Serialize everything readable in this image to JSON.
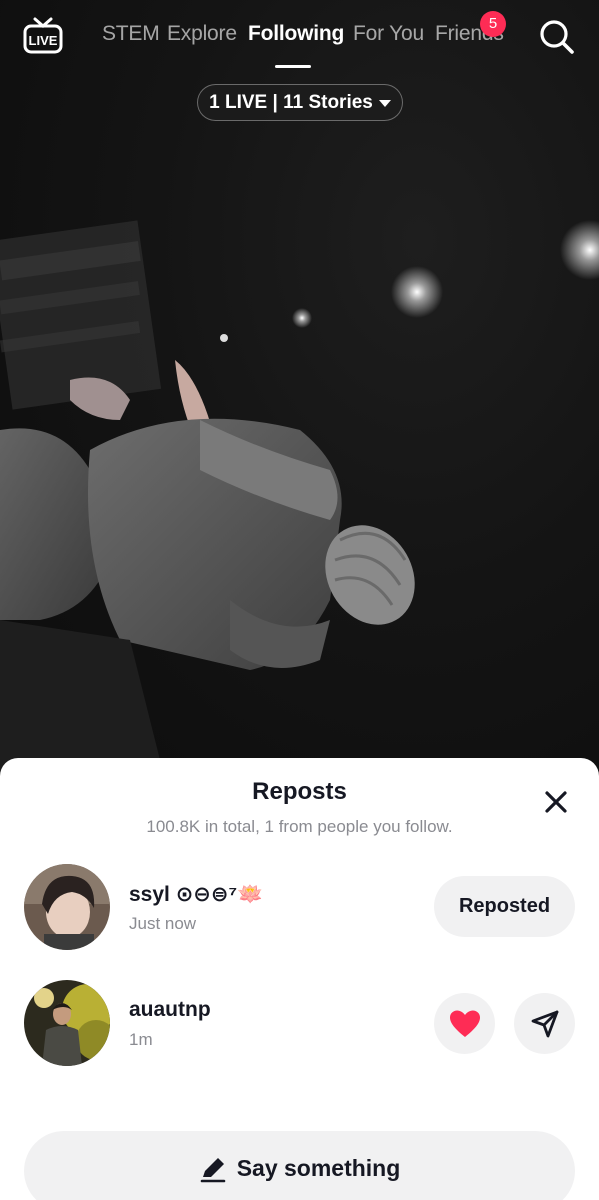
{
  "header": {
    "live_label": "LIVE",
    "tabs": [
      {
        "label": "STEM"
      },
      {
        "label": "Explore"
      },
      {
        "label": "Following"
      },
      {
        "label": "For You"
      },
      {
        "label": "Friends"
      }
    ],
    "active_tab": "Following",
    "friends_badge": "5",
    "stories_pill": "1 LIVE | 11 Stories",
    "icons": [
      "live-tv-icon",
      "search-icon",
      "caret-down-icon"
    ]
  },
  "reposts_sheet": {
    "title": "Reposts",
    "subtitle": "100.8K in total, 1 from people you follow.",
    "users": [
      {
        "name": "ssyl ⊙⊖⊜⁷🪷",
        "time": "Just now",
        "action_label": "Reposted"
      },
      {
        "name": "auautnp",
        "time": "1m",
        "actions": [
          "heart-icon",
          "send-icon"
        ]
      }
    ],
    "comment_placeholder": "Say something",
    "colors": {
      "heart": "#fe2c55",
      "badge": "#fe2c55",
      "button_bg": "#f1f1f2",
      "text": "#161823",
      "muted": "#8a8b91"
    }
  }
}
